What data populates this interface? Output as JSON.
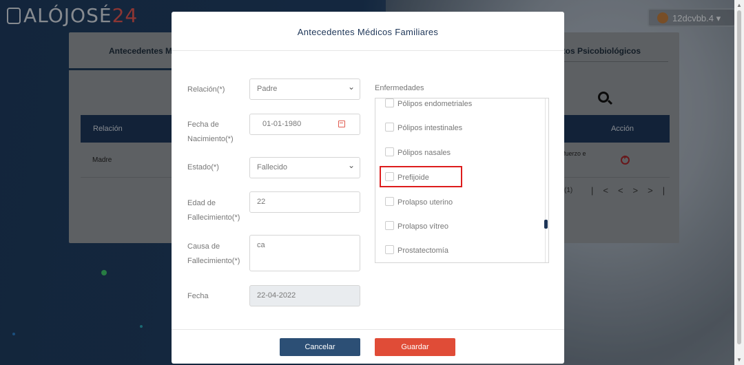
{
  "app": {
    "logo_prefix": "ALÓJOSÉ",
    "logo_suffix": "24"
  },
  "user": {
    "name": "12dcvbb.4 ▾"
  },
  "background": {
    "tab_left": "Antecedentes M",
    "tab_right": "itos Psicobiológicos",
    "table": {
      "col_relacion": "Relación",
      "col_accion": "Acción",
      "row_relacion": "Madre",
      "row_causa": "ifuerzo e",
      "pager_info": "(1)",
      "pager_buttons": "|<<>>|"
    }
  },
  "modal": {
    "title": "Antecedentes Médicos Familiares",
    "fields": {
      "relacion_label": "Relación(*)",
      "relacion_value": "Padre",
      "fecha_nac_label_1": "Fecha de",
      "fecha_nac_label_2": "Nacimiento(*)",
      "fecha_nac_value": "01-01-1980",
      "estado_label": "Estado(*)",
      "estado_value": "Fallecido",
      "edad_label_1": "Edad de",
      "edad_label_2": "Fallecimiento(*)",
      "edad_value": "22",
      "causa_label_1": "Causa de",
      "causa_label_2": "Fallecimiento(*)",
      "causa_value": "ca",
      "fecha_label": "Fecha",
      "fecha_value": "22-04-2022"
    },
    "enfermedades": {
      "label": "Enfermedades",
      "items": [
        "Pólipos endometriales",
        "Pólipos intestinales",
        "Pólipos nasales",
        "Prefijoide",
        "Prolapso uterino",
        "Prolapso vítreo",
        "Prostatectomía"
      ],
      "highlighted": "Prefijoide"
    },
    "buttons": {
      "cancel": "Cancelar",
      "save": "Guardar"
    }
  },
  "colors": {
    "primary": "#1d3557",
    "danger": "#e04c37",
    "highlight": "#dd1c1c"
  }
}
